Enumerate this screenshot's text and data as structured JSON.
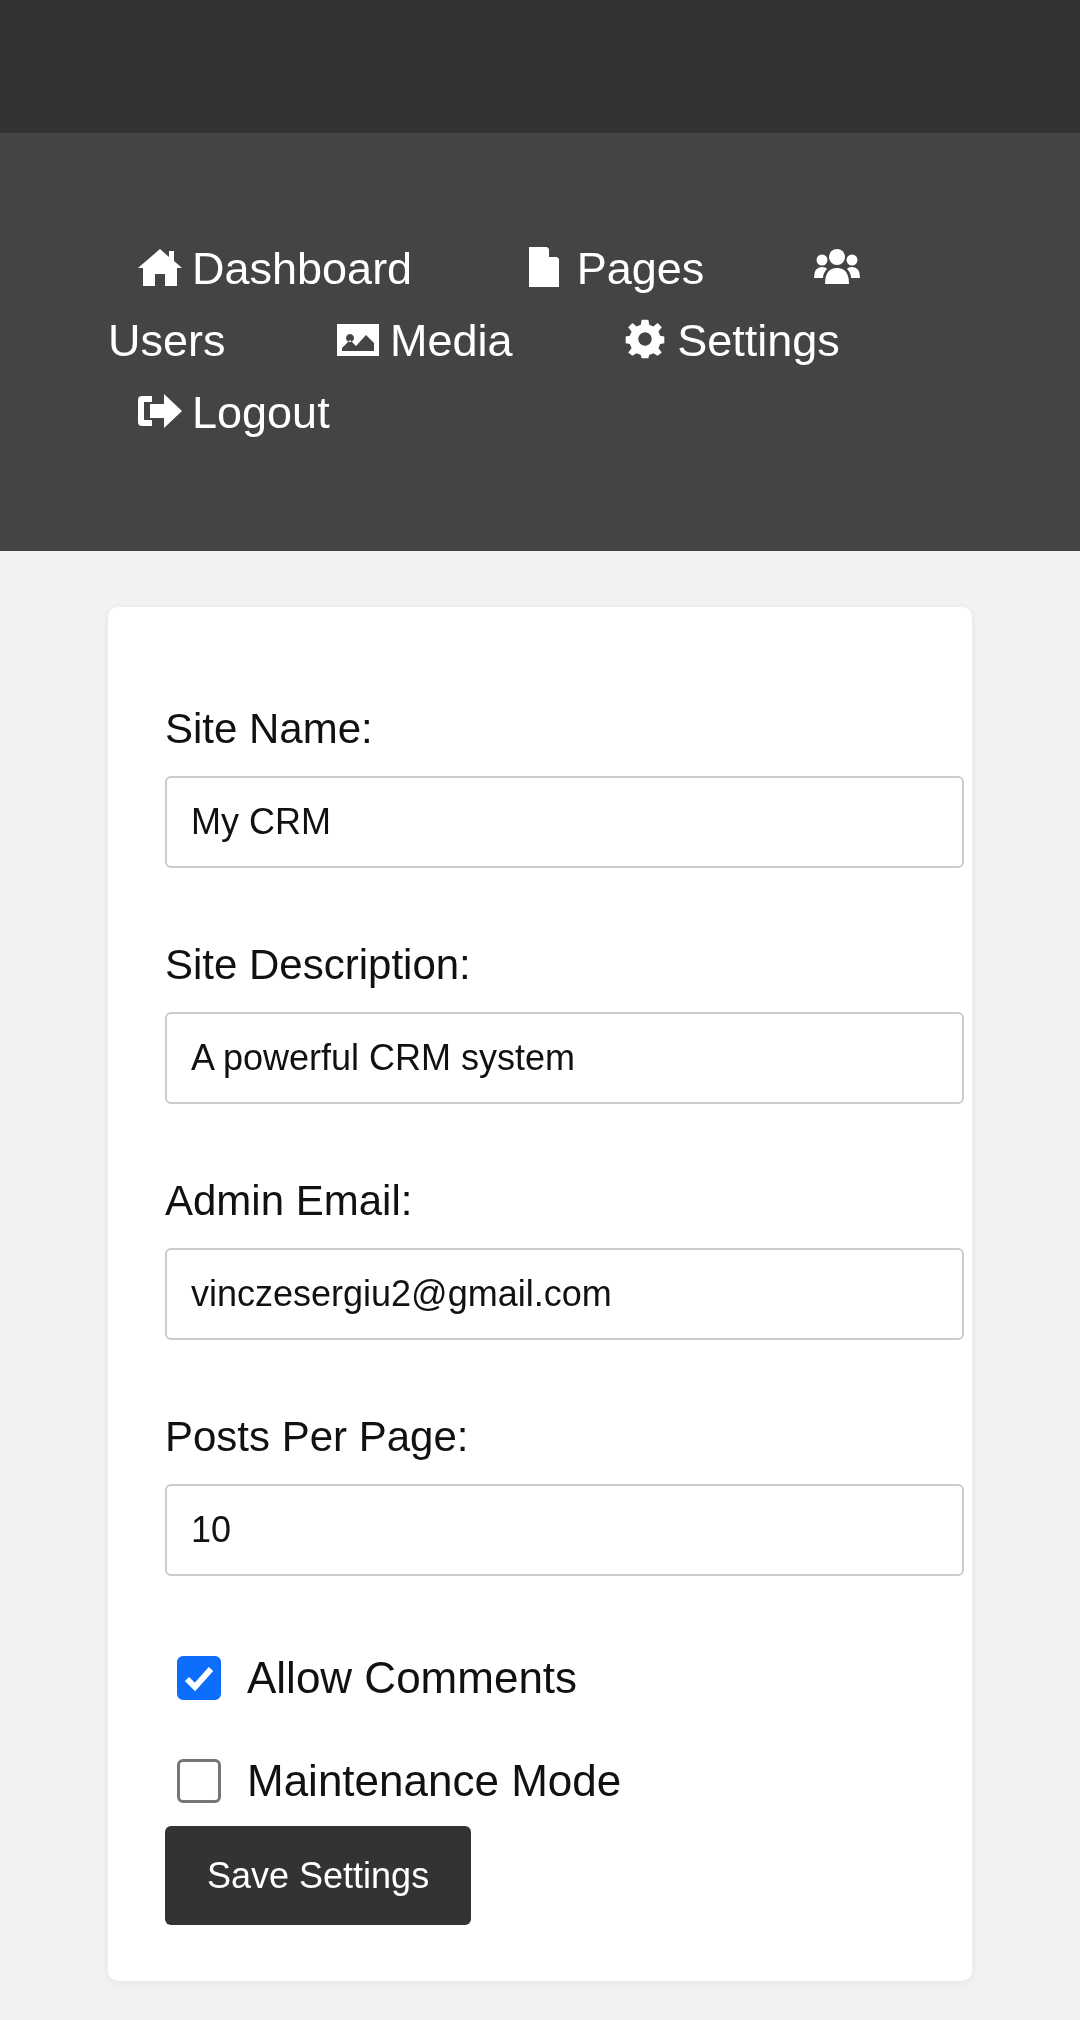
{
  "nav": [
    {
      "label": "Dashboard"
    },
    {
      "label": "Pages"
    },
    {
      "label": "Users"
    },
    {
      "label": "Media"
    },
    {
      "label": "Settings"
    },
    {
      "label": "Logout"
    }
  ],
  "fields": [
    {
      "label": "Site Name:",
      "value": "My CRM"
    },
    {
      "label": "Site Description:",
      "value": "A powerful CRM system"
    },
    {
      "label": "Admin Email:",
      "value": "vinczesergiu2@gmail.com"
    },
    {
      "label": "Posts Per Page:",
      "value": "10"
    }
  ],
  "checkboxes": [
    {
      "label": "Allow Comments",
      "checked": true
    },
    {
      "label": "Maintenance Mode",
      "checked": false
    }
  ],
  "button": "Save Settings"
}
